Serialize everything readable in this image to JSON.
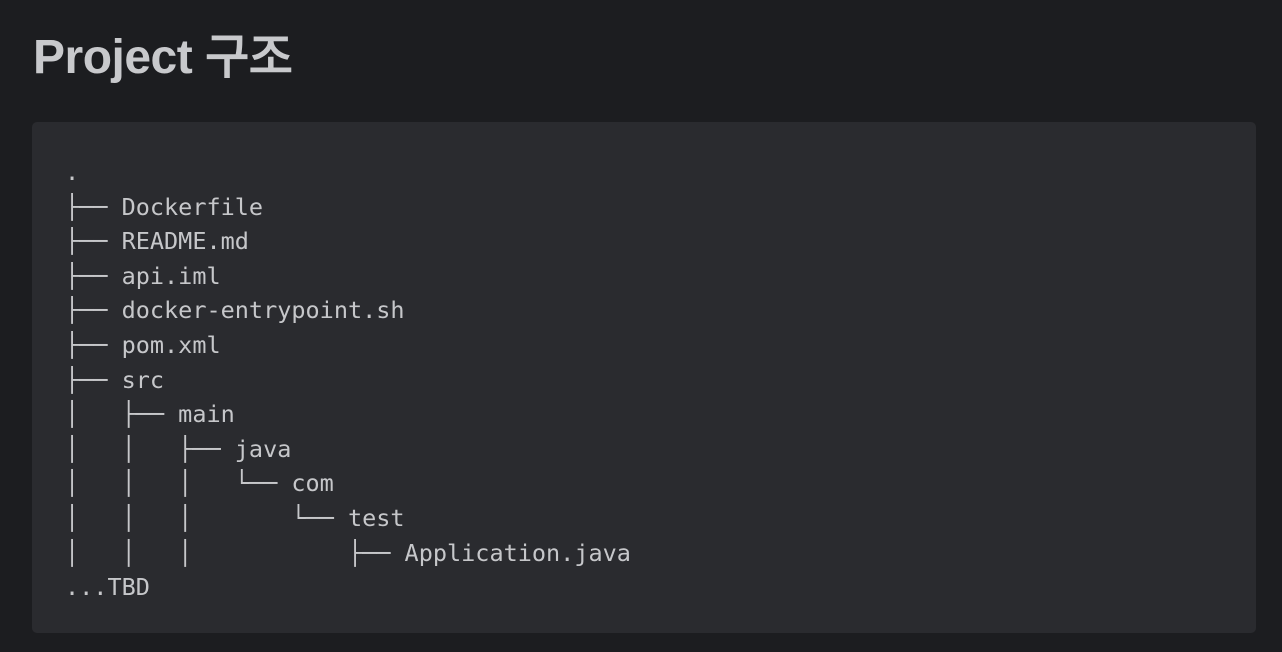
{
  "page": {
    "title": "Project 구조"
  },
  "code_block": {
    "lines": [
      ".",
      "├── Dockerfile",
      "├── README.md",
      "├── api.iml",
      "├── docker-entrypoint.sh",
      "├── pom.xml",
      "├── src",
      "│   ├── main",
      "│   │   ├── java",
      "│   │   │   └── com",
      "│   │   │       └── test",
      "│   │   │           ├── Application.java",
      "...TBD"
    ]
  },
  "colors": {
    "page_background": "#1c1d20",
    "code_background": "#2a2b2f",
    "title_text": "#c8c9cc",
    "code_text": "#c6c7ca"
  }
}
